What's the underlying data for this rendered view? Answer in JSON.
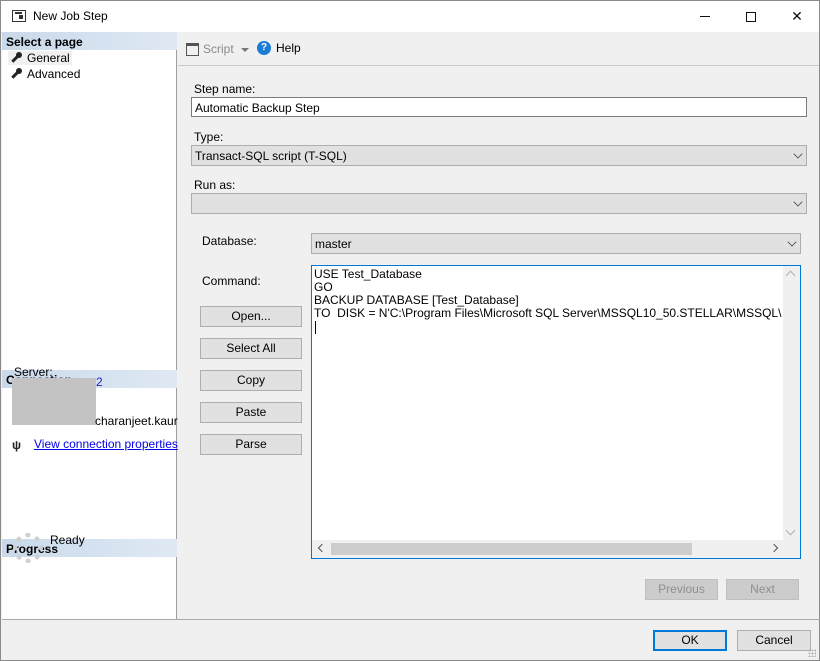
{
  "window": {
    "title": "New Job Step",
    "controls": {
      "minimize": "—",
      "maximize": "☐",
      "close": "✕"
    }
  },
  "left_pane": {
    "select_page_header": "Select a page",
    "pages": [
      {
        "label": "General",
        "icon": "wrench-icon",
        "selected": true
      },
      {
        "label": "Advanced",
        "icon": "wrench-icon",
        "selected": false
      }
    ],
    "connection": {
      "header": "Connection",
      "server_label": "Server:",
      "server_value_visible": "2",
      "user_value_visible": "charanjeet.kaur",
      "view_properties_link": "View connection properties",
      "icon": "plug-icon"
    },
    "progress": {
      "header": "Progress",
      "status": "Ready",
      "icon": "spinner-icon"
    }
  },
  "toolbar": {
    "script_label": "Script",
    "help_label": "Help"
  },
  "form": {
    "step_name_label": "Step name:",
    "step_name_value": "Automatic Backup Step",
    "type_label": "Type:",
    "type_value": "Transact-SQL script (T-SQL)",
    "run_as_label": "Run as:",
    "run_as_value": "",
    "database_label": "Database:",
    "database_value": "master",
    "command_label": "Command:",
    "command_text": "USE Test_Database\nGO\nBACKUP DATABASE [Test_Database]\nTO  DISK = N'C:\\Program Files\\Microsoft SQL Server\\MSSQL10_50.STELLAR\\MSSQL\\Backup\\T",
    "command_buttons": [
      "Open...",
      "Select All",
      "Copy",
      "Paste",
      "Parse"
    ]
  },
  "navigation": {
    "previous_label": "Previous",
    "next_label": "Next"
  },
  "footer": {
    "ok_label": "OK",
    "cancel_label": "Cancel"
  }
}
